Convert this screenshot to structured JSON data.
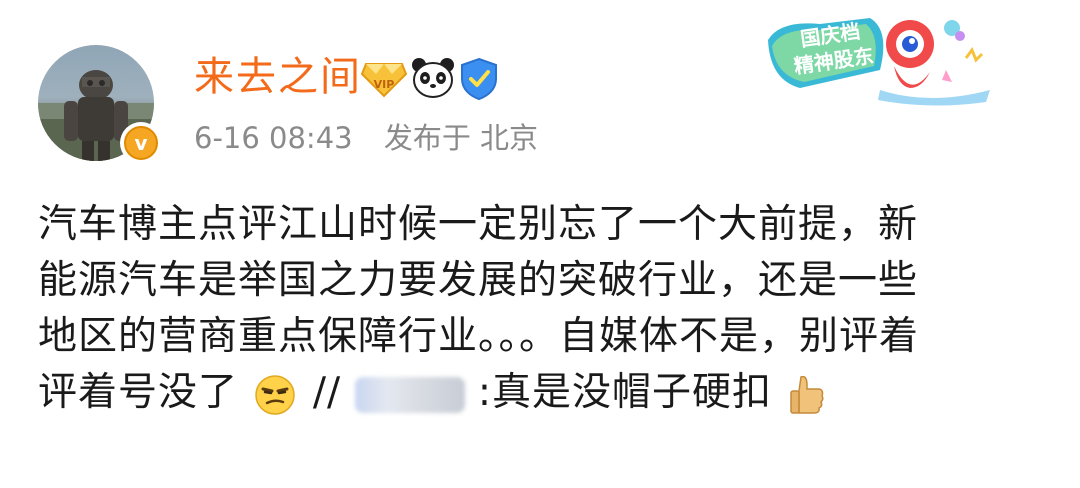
{
  "post": {
    "username": "来去之间",
    "date": "6-16 08:43",
    "location": "发布于 北京",
    "sticker_text": "国庆档\n精神股东",
    "body": {
      "line1": "汽车博主点评江山时候一定别忘了一个大前提，新",
      "line2": "能源汽车是举国之力要发展的突破行业，还是一些",
      "line3": "地区的营商重点保障行业。。。自媒体不是，别评着",
      "line4_a": "评着号没了",
      "line4_repost": "//",
      "line4_b": ":真是没帽子硬扣"
    },
    "icons": {
      "avatar": "robot-avatar",
      "verified": "verified-badge-icon",
      "vip": "vip-diamond-icon",
      "panda": "panda-icon",
      "shield": "shield-check-icon",
      "smirk": "smirk-emoji",
      "thumbs_up": "thumbs-up-emoji"
    },
    "colors": {
      "username": "#f36a1a",
      "meta": "#8a8a8a",
      "text": "#1a1a1a"
    }
  }
}
